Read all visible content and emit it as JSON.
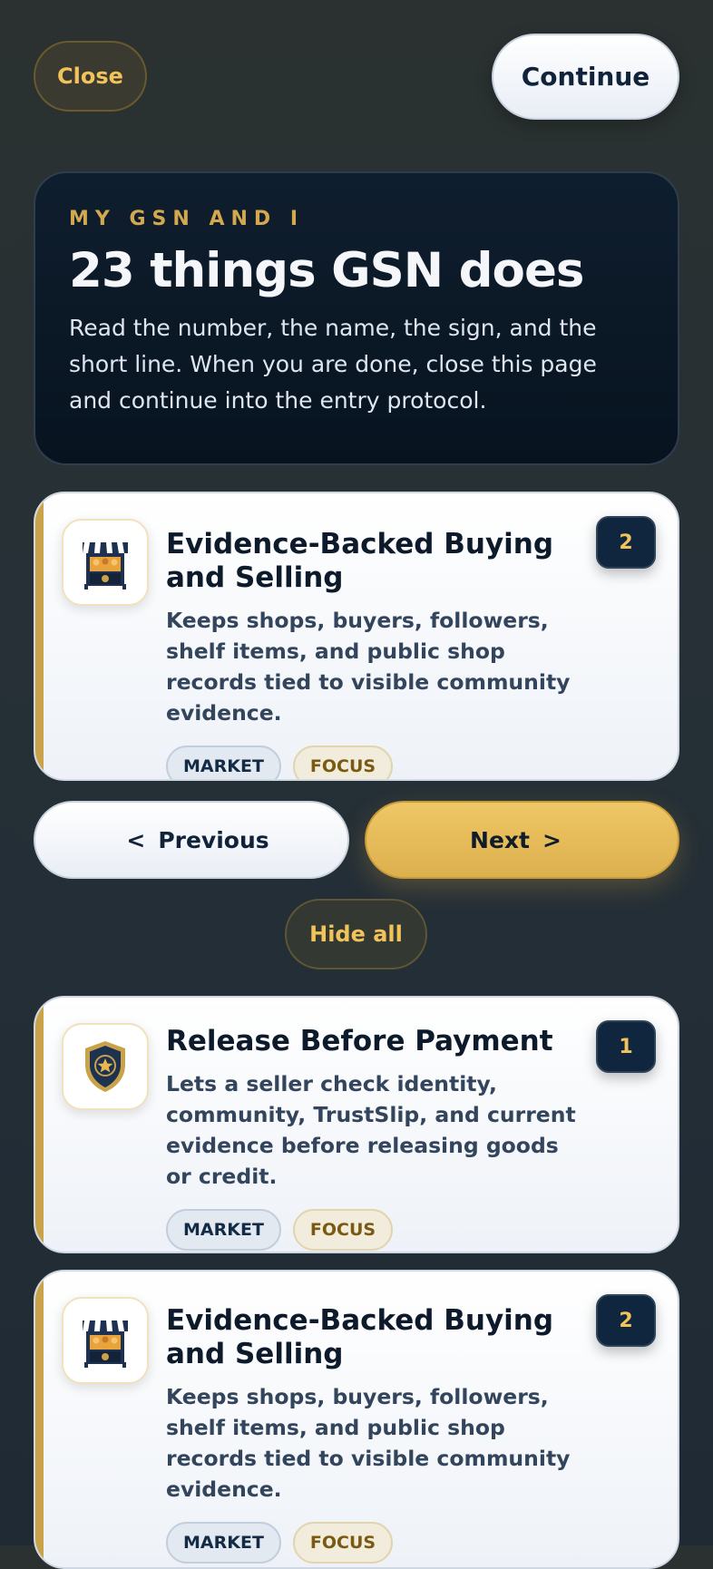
{
  "header": {
    "close_label": "Close",
    "continue_label": "Continue"
  },
  "hero": {
    "eyebrow": "MY GSN AND I",
    "title": "23 things GSN does",
    "text": "Read the number, the name, the sign, and the short line. When you are done, close this page and continue into the entry protocol."
  },
  "cards": [
    {
      "number": "2",
      "icon": "market-stall-icon",
      "title": "Evidence-Backed Buying and Selling",
      "desc": "Keeps shops, buyers, followers, shelf items, and public shop records tied to visible community evidence.",
      "tags": [
        "MARKET",
        "FOCUS"
      ]
    },
    {
      "number": "1",
      "icon": "shield-star-icon",
      "title": "Release Before Payment",
      "desc": "Lets a seller check identity, community, TrustSlip, and current evidence before releasing goods or credit.",
      "tags": [
        "MARKET",
        "FOCUS"
      ]
    },
    {
      "number": "2",
      "icon": "market-stall-icon",
      "title": "Evidence-Backed Buying and Selling",
      "desc": "Keeps shops, buyers, followers, shelf items, and public shop records tied to visible community evidence.",
      "tags": [
        "MARKET",
        "FOCUS"
      ]
    }
  ],
  "nav": {
    "previous_label": "Previous",
    "next_label": "Next",
    "prev_chevron": "<",
    "next_chevron": ">"
  },
  "hide_all_label": "Hide all",
  "colors": {
    "accent_gold": "#ddb04e",
    "navy": "#10263f",
    "background": "#263036"
  }
}
